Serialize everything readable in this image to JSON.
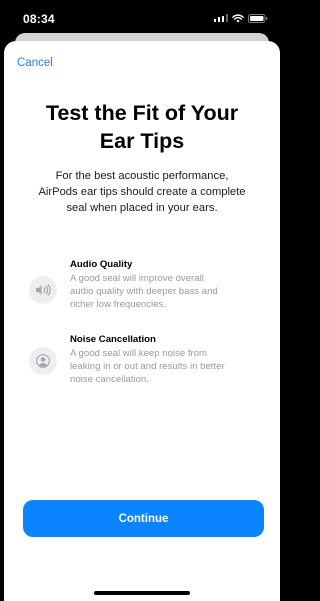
{
  "status_bar": {
    "time": "08:34",
    "icons": [
      "cellular-signal-icon",
      "wifi-icon",
      "battery-icon"
    ]
  },
  "sheet": {
    "cancel_label": "Cancel",
    "title_lines": [
      "Test the Fit of Your",
      "Ear Tips"
    ],
    "subtitle_lines": [
      "For the best acoustic performance,",
      "AirPods ear tips should create a complete",
      "seal when placed in your ears."
    ],
    "features": [
      {
        "icon": "speaker-sound-icon",
        "heading": "Audio Quality",
        "lines": [
          "A good seal will improve overall",
          "audio quality with deeper bass and",
          "richer low frequencies."
        ]
      },
      {
        "icon": "person-icon",
        "heading": "Noise Cancellation",
        "lines": [
          "A good seal will keep noise from",
          "leaking in or out and results in better",
          "noise cancellation."
        ]
      }
    ],
    "continue_label": "Continue"
  },
  "colors": {
    "accent": "#0a84ff",
    "link": "#2b7ce9",
    "secondary_text": "#9a9aa0"
  }
}
